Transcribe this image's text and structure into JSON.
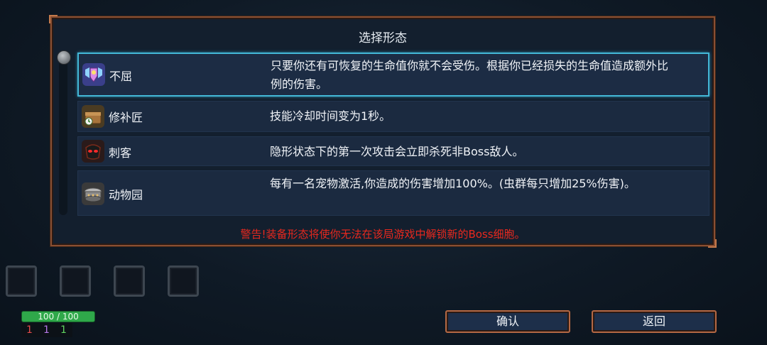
{
  "dialog": {
    "title": "选择形态",
    "warning": "警告!装备形态将使你无法在该局游戏中解锁新的Boss细胞。",
    "mutations": [
      {
        "name": "不屈",
        "icon": "shield-wings-icon",
        "description": "只要你还有可恢复的生命值你就不会受伤。根据你已经损失的生命值造成额外比例的伤害。",
        "selected": true
      },
      {
        "name": "修补匠",
        "icon": "treasure-chest-clock-icon",
        "description": "技能冷却时间变为1秒。",
        "selected": false
      },
      {
        "name": "刺客",
        "icon": "red-eyes-mask-icon",
        "description": "隐形状态下的第一次攻击会立即杀死非Boss敌人。",
        "selected": false
      },
      {
        "name": "动物园",
        "icon": "pet-cage-icon",
        "description": "每有一名宠物激活,你造成的伤害增加100%。(虫群每只增加25%伤害)。",
        "selected": false
      }
    ]
  },
  "hud": {
    "hp_text": "100 / 100",
    "hp_fraction": 1.0,
    "stats": [
      "1",
      "1",
      "1"
    ],
    "stat_colors": [
      "#e24a4a",
      "#b678e8",
      "#5fd45f"
    ]
  },
  "buttons": {
    "confirm": "确认",
    "back": "返回"
  },
  "colors": {
    "selected_border": "#43b7d6",
    "warning": "#e8281e",
    "frame": "#8a4f32"
  }
}
